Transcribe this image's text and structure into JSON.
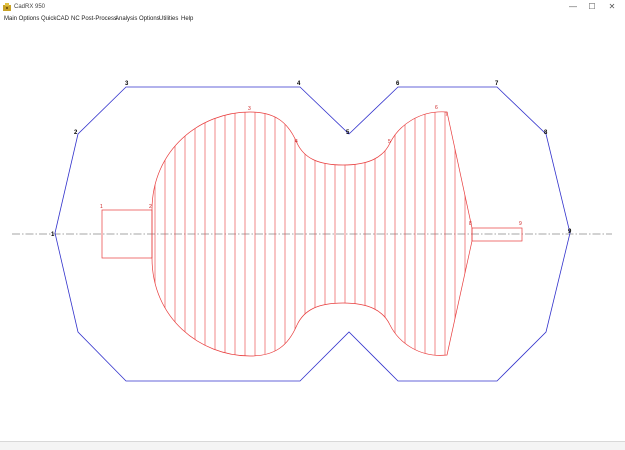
{
  "window": {
    "title": "CadRX 950",
    "minimize_glyph": "—",
    "maximize_glyph": "☐",
    "close_glyph": "✕"
  },
  "menu": {
    "items": [
      {
        "label": "Main Options"
      },
      {
        "label": "QuickCAD"
      },
      {
        "label": "NC Post-Process"
      },
      {
        "label": "Analysis Options"
      },
      {
        "label": "Utilities"
      },
      {
        "label": "Help"
      }
    ]
  },
  "drawing": {
    "blue_point_labels": [
      "1",
      "2",
      "3",
      "4",
      "5",
      "6",
      "7",
      "8",
      "9"
    ],
    "red_point_labels": [
      "1",
      "2",
      "3",
      "4",
      "5",
      "6",
      "7",
      "8",
      "9"
    ],
    "colors": {
      "outline": "#3333cc",
      "part": "#e83c3c",
      "centerline": "#888888",
      "label_blue": "#000000",
      "label_red": "#cc2222"
    }
  }
}
